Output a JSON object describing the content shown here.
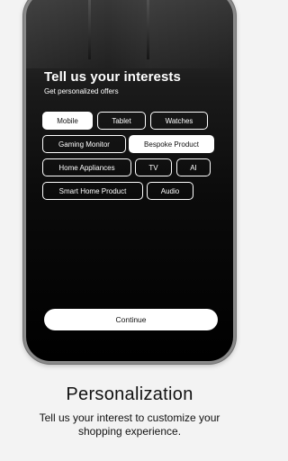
{
  "header": {
    "title": "Tell us your interests",
    "subtitle": "Get personalized offers"
  },
  "interests": [
    {
      "label": "Mobile",
      "selected": true
    },
    {
      "label": "Tablet",
      "selected": false
    },
    {
      "label": "Watches",
      "selected": false
    },
    {
      "label": "Gaming Monitor",
      "selected": false
    },
    {
      "label": "Bespoke Product",
      "selected": true
    },
    {
      "label": "Home Appliances",
      "selected": false
    },
    {
      "label": "TV",
      "selected": false
    },
    {
      "label": "AI",
      "selected": false
    },
    {
      "label": "Smart Home Product",
      "selected": false
    },
    {
      "label": "Audio",
      "selected": false
    }
  ],
  "continue_label": "Continue",
  "caption": {
    "title": "Personalization",
    "body": "Tell us your interest to customize your shopping experience."
  },
  "colors": {
    "background": "#f3f3f3",
    "screen": "#000000",
    "chip_selected_bg": "#ffffff",
    "chip_border": "#ffffff"
  }
}
